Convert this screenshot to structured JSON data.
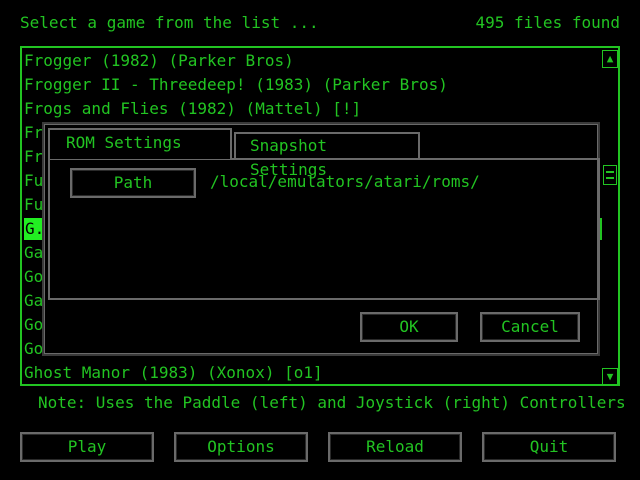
{
  "header": {
    "prompt": "Select a game from the list ...",
    "file_count": "495 files found"
  },
  "game_list": {
    "rows": [
      {
        "label": "Frogger (1982) (Parker Bros)"
      },
      {
        "label": "Frogger II - Threedeep! (1983) (Parker Bros)"
      },
      {
        "label": "Frogs and Flies (1982) (Mattel) [!]"
      },
      {
        "label": "Fr"
      },
      {
        "label": "Fr"
      },
      {
        "label": "Fu"
      },
      {
        "label": "Fu"
      },
      {
        "label": "G.I"
      },
      {
        "label": "Ga"
      },
      {
        "label": "Go"
      },
      {
        "label": "Ga"
      },
      {
        "label": "Go"
      },
      {
        "label": "Go"
      },
      {
        "label": "Ghost Manor (1983) (Xonox) [o1]"
      }
    ],
    "selected_index": 7
  },
  "scrollbar": {
    "up_glyph": "▲",
    "down_glyph": "▼"
  },
  "dialog": {
    "tabs": [
      {
        "label": "ROM Settings",
        "active": true
      },
      {
        "label": "Snapshot Settings",
        "active": false
      }
    ],
    "path_button_label": "Path",
    "path_value": "/local/emulators/atari/roms/",
    "ok_label": "OK",
    "cancel_label": "Cancel"
  },
  "note": "Note:  Uses the Paddle (left) and Joystick (right) Controllers",
  "buttons": {
    "play": "Play",
    "options": "Options",
    "reload": "Reload",
    "quit": "Quit"
  },
  "colors": {
    "text": "#22c422",
    "highlight": "#22ee22",
    "background": "#000000",
    "frame": "#6a6a6a"
  }
}
